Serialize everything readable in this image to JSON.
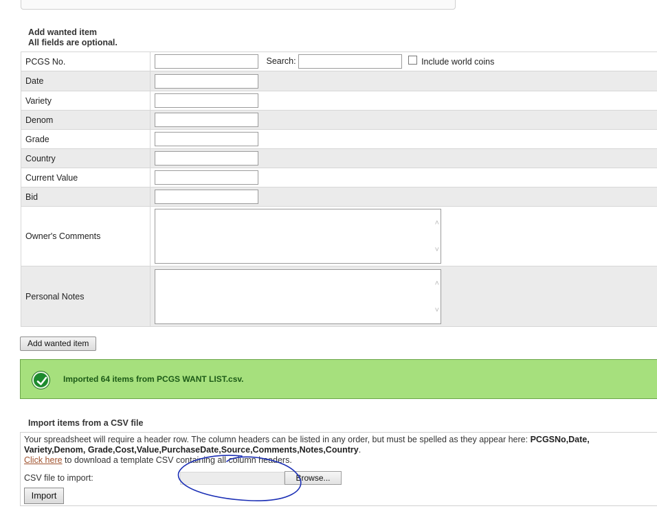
{
  "add_section": {
    "title": "Add wanted item",
    "subtitle": "All fields are optional."
  },
  "fields": {
    "pcgs_no": "PCGS No.",
    "search_label": "Search:",
    "include_world_label": "Include world coins",
    "date": "Date",
    "variety": "Variety",
    "denom": "Denom",
    "grade": "Grade",
    "country": "Country",
    "current_value": "Current Value",
    "bid": "Bid",
    "owners_comments": "Owner's Comments",
    "personal_notes": "Personal Notes"
  },
  "add_button": "Add wanted item",
  "status": {
    "message": "Imported 64 items from PCGS WANT LIST.csv.",
    "color": "#a6e07d"
  },
  "import_section": {
    "title": "Import items from a CSV file",
    "instructions": "Your spreadsheet will require a header row. The column headers can be listed in any order, but must be spelled as they appear here:",
    "headers_list": "PCGSNo,Date, Variety,Denom, Grade,Cost,Value,PurchaseDate,Source,Comments,Notes,Country",
    "period": ".",
    "link_text": "Click here",
    "link_suffix": " to download a template CSV containing all column headers.",
    "file_label": "CSV file to import:",
    "browse_label": "Browse...",
    "import_button": "Import"
  }
}
